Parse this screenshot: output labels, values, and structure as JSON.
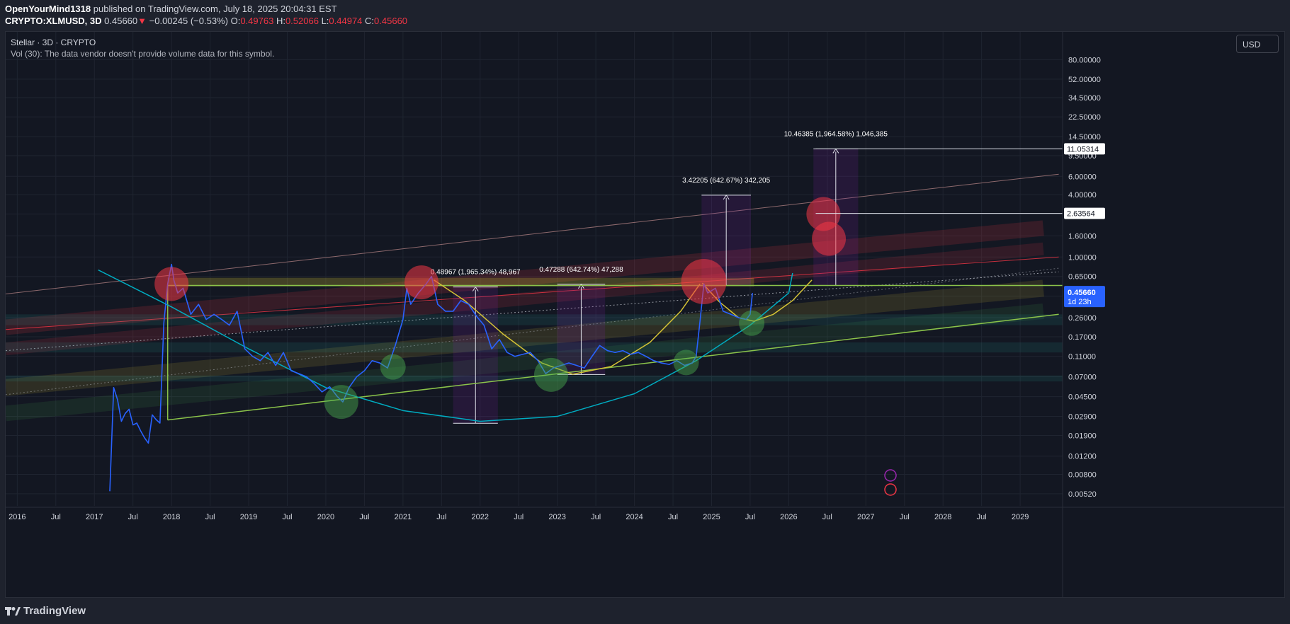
{
  "header": {
    "author": "OpenYourMind1318",
    "published_text": "published on TradingView.com, July 18, 2025 20:04:31 EST",
    "symbol": "CRYPTO:XLMUSD, 3D",
    "last_price": "0.45660",
    "change": "−0.00245 (−0.53%)",
    "o_label": "O:",
    "o_value": "0.49763",
    "h_label": "H:",
    "h_value": "0.52066",
    "l_label": "L:",
    "l_value": "0.44974",
    "c_label": "C:",
    "c_value": "0.45660"
  },
  "legend": {
    "title": "Stellar · 3D · CRYPTO",
    "volume_note": "Vol (30): The data vendor doesn't provide volume data for this symbol."
  },
  "currency_button": "USD",
  "footer": {
    "logo_text": "TradingView"
  },
  "colors": {
    "background": "#131722",
    "price_line": "#2962ff",
    "price_badge": "#2962ff",
    "resistance_line": "#8bc34a",
    "red_zone": "#f23645",
    "green_zone": "#4caf50",
    "teal_arc": "#00acc1",
    "yellow_arc": "#d4c235"
  },
  "chart_data": {
    "type": "line",
    "scale": "log",
    "symbol": "CRYPTO:XLMUSD",
    "ylim": [
      0.0048,
      90
    ],
    "xlim": [
      2015.85,
      2029.55
    ],
    "y_ticks": [
      "80.00000",
      "52.00000",
      "34.50000",
      "22.50000",
      "14.50000",
      "9.50000",
      "6.00000",
      "4.00000",
      "2.60000",
      "1.60000",
      "1.00000",
      "0.65000",
      "0.42000",
      "0.26000",
      "0.17000",
      "0.11000",
      "0.07000",
      "0.04500",
      "0.02900",
      "0.01900",
      "0.01200",
      "0.00800",
      "0.00520"
    ],
    "y_tick_values": [
      80,
      52,
      34.5,
      22.5,
      14.5,
      9.5,
      6,
      4,
      2.6,
      1.6,
      1,
      0.65,
      0.42,
      0.26,
      0.17,
      0.11,
      0.07,
      0.045,
      0.029,
      0.019,
      0.012,
      0.008,
      0.0052
    ],
    "x_ticks": [
      {
        "label": "2016",
        "t": 2016.0
      },
      {
        "label": "Jul",
        "t": 2016.5
      },
      {
        "label": "2017",
        "t": 2017.0
      },
      {
        "label": "Jul",
        "t": 2017.5
      },
      {
        "label": "2018",
        "t": 2018.0
      },
      {
        "label": "Jul",
        "t": 2018.5
      },
      {
        "label": "2019",
        "t": 2019.0
      },
      {
        "label": "Jul",
        "t": 2019.5
      },
      {
        "label": "2020",
        "t": 2020.0
      },
      {
        "label": "Jul",
        "t": 2020.5
      },
      {
        "label": "2021",
        "t": 2021.0
      },
      {
        "label": "Jul",
        "t": 2021.5
      },
      {
        "label": "2022",
        "t": 2022.0
      },
      {
        "label": "Jul",
        "t": 2022.5
      },
      {
        "label": "2023",
        "t": 2023.0
      },
      {
        "label": "Jul",
        "t": 2023.5
      },
      {
        "label": "2024",
        "t": 2024.0
      },
      {
        "label": "Jul",
        "t": 2024.5
      },
      {
        "label": "2025",
        "t": 2025.0
      },
      {
        "label": "Jul",
        "t": 2025.5
      },
      {
        "label": "2026",
        "t": 2026.0
      },
      {
        "label": "Jul",
        "t": 2026.5
      },
      {
        "label": "2027",
        "t": 2027.0
      },
      {
        "label": "Jul",
        "t": 2027.5
      },
      {
        "label": "2028",
        "t": 2028.0
      },
      {
        "label": "Jul",
        "t": 2028.5
      },
      {
        "label": "2029",
        "t": 2029.0
      }
    ],
    "series": [
      {
        "name": "XLMUSD",
        "x": [
          2017.2,
          2017.25,
          2017.3,
          2017.35,
          2017.4,
          2017.45,
          2017.5,
          2017.55,
          2017.6,
          2017.65,
          2017.7,
          2017.75,
          2017.8,
          2017.85,
          2017.9,
          2017.95,
          2018.0,
          2018.03,
          2018.08,
          2018.15,
          2018.25,
          2018.35,
          2018.45,
          2018.55,
          2018.65,
          2018.75,
          2018.85,
          2018.95,
          2019.05,
          2019.15,
          2019.25,
          2019.35,
          2019.45,
          2019.55,
          2019.65,
          2019.75,
          2019.85,
          2019.95,
          2020.05,
          2020.15,
          2020.22,
          2020.3,
          2020.4,
          2020.5,
          2020.6,
          2020.7,
          2020.8,
          2020.9,
          2021.0,
          2021.05,
          2021.1,
          2021.2,
          2021.3,
          2021.37,
          2021.45,
          2021.55,
          2021.65,
          2021.75,
          2021.85,
          2021.95,
          2022.05,
          2022.15,
          2022.25,
          2022.35,
          2022.45,
          2022.55,
          2022.65,
          2022.75,
          2022.85,
          2022.95,
          2023.05,
          2023.15,
          2023.25,
          2023.35,
          2023.45,
          2023.55,
          2023.65,
          2023.75,
          2023.85,
          2023.95,
          2024.05,
          2024.15,
          2024.25,
          2024.35,
          2024.45,
          2024.55,
          2024.65,
          2024.75,
          2024.8,
          2024.85,
          2024.9,
          2024.95,
          2025.05,
          2025.15,
          2025.25,
          2025.35,
          2025.45,
          2025.5,
          2025.53
        ],
        "y": [
          0.0055,
          0.055,
          0.042,
          0.026,
          0.031,
          0.034,
          0.024,
          0.025,
          0.021,
          0.018,
          0.016,
          0.03,
          0.027,
          0.025,
          0.23,
          0.55,
          0.85,
          0.6,
          0.45,
          0.5,
          0.28,
          0.35,
          0.25,
          0.28,
          0.25,
          0.22,
          0.3,
          0.13,
          0.11,
          0.1,
          0.12,
          0.09,
          0.12,
          0.08,
          0.075,
          0.07,
          0.06,
          0.05,
          0.056,
          0.045,
          0.04,
          0.055,
          0.07,
          0.08,
          0.1,
          0.095,
          0.085,
          0.14,
          0.25,
          0.5,
          0.35,
          0.45,
          0.55,
          0.65,
          0.35,
          0.3,
          0.3,
          0.38,
          0.35,
          0.27,
          0.22,
          0.13,
          0.16,
          0.12,
          0.11,
          0.115,
          0.12,
          0.1,
          0.075,
          0.085,
          0.09,
          0.095,
          0.09,
          0.085,
          0.11,
          0.14,
          0.125,
          0.12,
          0.125,
          0.115,
          0.12,
          0.11,
          0.1,
          0.095,
          0.092,
          0.1,
          0.09,
          0.095,
          0.11,
          0.24,
          0.55,
          0.45,
          0.5,
          0.3,
          0.28,
          0.26,
          0.25,
          0.28,
          0.45
        ]
      }
    ],
    "current_price": 0.4566,
    "current_price_label": "0.45660",
    "countdown": "1d 23h",
    "price_labels": [
      {
        "value": 11.05314,
        "label": "11.05314"
      },
      {
        "value": 2.63564,
        "label": "2.63564"
      }
    ],
    "measurements": [
      {
        "label": "0.48967 (1,965.34%) 48,967",
        "t0": 2021.65,
        "t1": 2022.23,
        "y_low": 0.0249,
        "y_high": 0.514
      },
      {
        "label": "0.47288 (642.74%) 47,288",
        "t0": 2023.0,
        "t1": 2023.62,
        "y_low": 0.0735,
        "y_high": 0.546
      },
      {
        "label": "3.42205 (642.67%) 342,205",
        "t0": 2024.87,
        "t1": 2025.51,
        "y_low": 0.532,
        "y_high": 3.95
      },
      {
        "label": "10.46385 (1,964.58%) 1,046,385",
        "t0": 2026.32,
        "t1": 2026.9,
        "y_low": 0.532,
        "y_high": 11.05
      }
    ],
    "markers": {
      "red": [
        {
          "t": 2018.0,
          "y": 0.55,
          "size": "medium"
        },
        {
          "t": 2021.24,
          "y": 0.57,
          "size": "medium"
        },
        {
          "t": 2024.9,
          "y": 0.58,
          "size": "large"
        },
        {
          "t": 2026.45,
          "y": 2.6,
          "size": "medium"
        },
        {
          "t": 2026.52,
          "y": 1.5,
          "size": "medium"
        }
      ],
      "green": [
        {
          "t": 2020.2,
          "y": 0.04,
          "size": "medium"
        },
        {
          "t": 2020.87,
          "y": 0.087,
          "size": "small"
        },
        {
          "t": 2022.92,
          "y": 0.073,
          "size": "medium"
        },
        {
          "t": 2024.67,
          "y": 0.096,
          "size": "small"
        },
        {
          "t": 2025.52,
          "y": 0.23,
          "size": "small"
        }
      ]
    },
    "levels": {
      "resistance": 0.532,
      "green_box_low": 0.0268,
      "support_trend": {
        "t0": 2017.95,
        "y0": 0.0268,
        "t1": 2029.5,
        "y1": 0.28
      }
    }
  }
}
